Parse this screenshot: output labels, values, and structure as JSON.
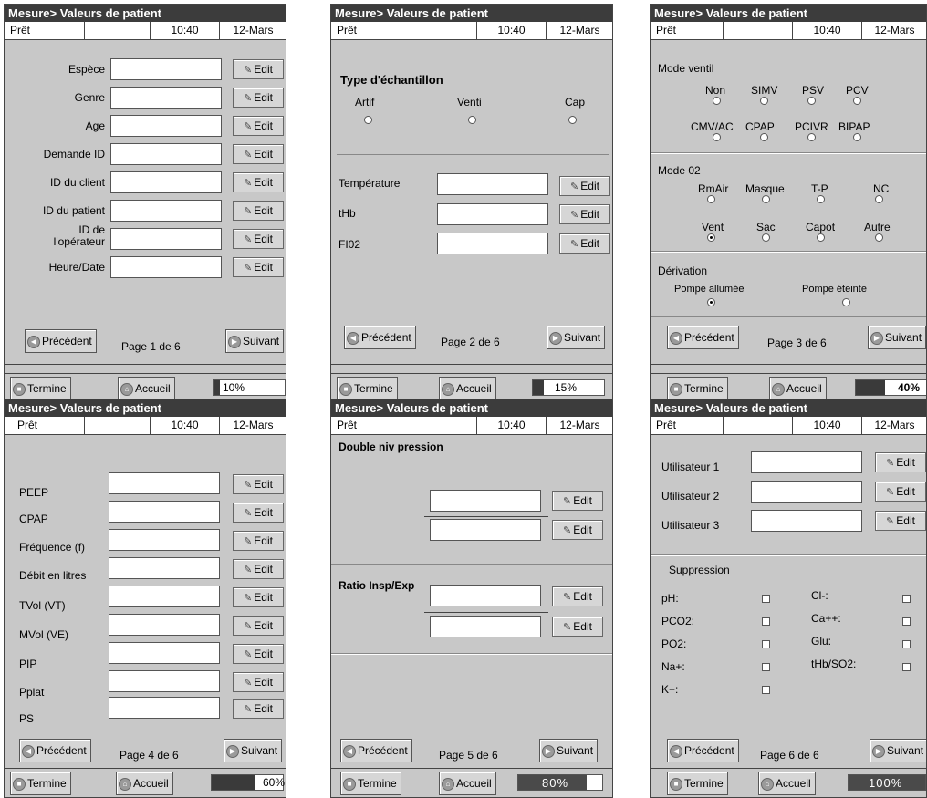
{
  "common": {
    "title": "Mesure> Valeurs de patient",
    "status": "Prêt",
    "time": "10:40",
    "date": "12-Mars",
    "edit_label": "Edit",
    "prev_label": "Précédent",
    "next_label": "Suivant",
    "finish_label": "Termine",
    "home_label": "Accueil"
  },
  "page1": {
    "fields": [
      "Espèce",
      "Genre",
      "Age",
      "Demande ID",
      "ID du client",
      "ID du patient",
      "ID de l'opérateur",
      "Heure/Date"
    ],
    "page_info": "Page 1 de 6",
    "progress": "10%"
  },
  "page2": {
    "sample_type_label": "Type d'échantillon",
    "sample_types": [
      "Artif",
      "Venti",
      "Cap"
    ],
    "fields": [
      "Température",
      "tHb",
      "FI02"
    ],
    "page_info": "Page 2 de 6",
    "progress": "15%"
  },
  "page3": {
    "vent_mode_label": "Mode ventil",
    "vent_modes_row1": [
      "Non",
      "SIMV",
      "PSV",
      "PCV"
    ],
    "vent_modes_row2": [
      "CMV/AC",
      "CPAP",
      "PCIVR",
      "BIPAP"
    ],
    "o2_mode_label": "Mode 02",
    "o2_modes_row1": [
      "RmAir",
      "Masque",
      "T-P",
      "NC"
    ],
    "o2_modes_row2": [
      "Vent",
      "Sac",
      "Capot",
      "Autre"
    ],
    "derivation_label": "Dérivation",
    "derivation_options": [
      "Pompe allumée",
      "Pompe éteinte"
    ],
    "page_info": "Page 3 de 6",
    "progress": "40%"
  },
  "page4": {
    "fields": [
      "PEEP",
      "CPAP",
      "Fréquence (f)",
      "Débit en litres",
      "TVol (VT)",
      "MVol (VE)",
      "PIP",
      "Pplat",
      "PS"
    ],
    "page_info": "Page 4 de 6",
    "progress": "60%"
  },
  "page5": {
    "pressure_label": "Double niv pression",
    "ratio_label": "Ratio Insp/Exp",
    "page_info": "Page 5 de 6",
    "progress": "80%"
  },
  "page6": {
    "fields": [
      "Utilisateur 1",
      "Utilisateur 2",
      "Utilisateur 3"
    ],
    "suppression_label": "Suppression",
    "suppression_left": [
      "pH:",
      "PCO2:",
      "PO2:",
      "Na+:",
      "K+:"
    ],
    "suppression_right": [
      "Cl-:",
      "Ca++:",
      "Glu:",
      "tHb/SO2:"
    ],
    "page_info": "Page 6 de 6",
    "progress": "100%"
  }
}
